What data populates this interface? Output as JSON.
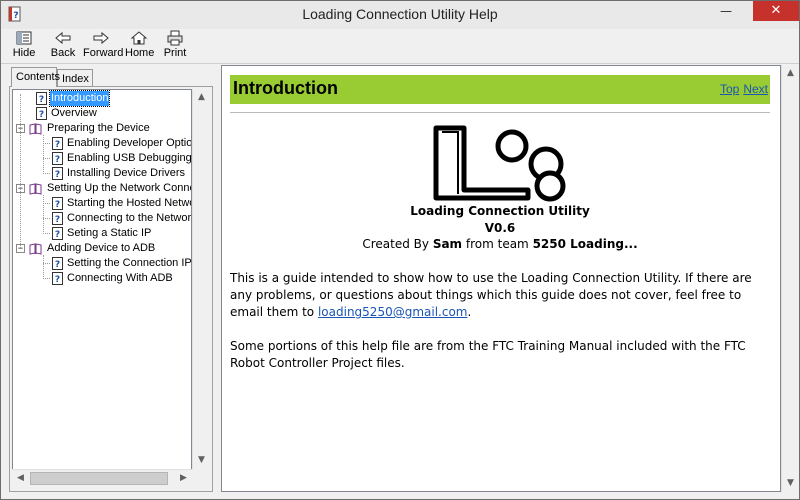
{
  "window": {
    "title": "Loading Connection Utility Help",
    "minimize_glyph": "—",
    "close_glyph": "✕"
  },
  "toolbar": {
    "hide": "Hide",
    "back": "Back",
    "forward": "Forward",
    "home": "Home",
    "print": "Print"
  },
  "tabs": {
    "contents": "Contents",
    "index": "Index"
  },
  "tree": {
    "items": [
      {
        "label": "Introduction",
        "type": "page",
        "level": 1,
        "selected": true
      },
      {
        "label": "Overview",
        "type": "page",
        "level": 1
      },
      {
        "label": "Preparing the Device",
        "type": "book",
        "level": 0
      },
      {
        "label": "Enabling Developer Options",
        "type": "page",
        "level": 2
      },
      {
        "label": "Enabling USB Debugging",
        "type": "page",
        "level": 2
      },
      {
        "label": "Installing Device Drivers",
        "type": "page",
        "level": 2
      },
      {
        "label": "Setting Up the Network Connectio",
        "type": "book",
        "level": 0
      },
      {
        "label": "Starting the Hosted Network",
        "type": "page",
        "level": 2
      },
      {
        "label": "Connecting to the Network",
        "type": "page",
        "level": 2
      },
      {
        "label": "Seting a Static IP",
        "type": "page",
        "level": 2
      },
      {
        "label": "Adding Device to ADB",
        "type": "book",
        "level": 0
      },
      {
        "label": "Setting the Connection IP",
        "type": "page",
        "level": 2
      },
      {
        "label": "Connecting With ADB",
        "type": "page",
        "level": 2
      }
    ]
  },
  "content": {
    "heading": "Introduction",
    "link_top": "Top",
    "link_next": "Next",
    "app_name": "Loading Connection Utility",
    "version": "V0.6",
    "credit_prefix": "Created By ",
    "credit_name": "Sam",
    "credit_mid": " from team ",
    "credit_team": "5250 Loading...",
    "para1": "This is a guide intended to show how to use the Loading Connection Utility. If there are any problems, or questions about things which this guide does not cover, feel free to email them to ",
    "email": "loading5250@gmail.com",
    "para1_end": ".",
    "para2": "Some portions of this help file are from the FTC Training Manual included with the FTC Robot Controller Project files."
  },
  "colors": {
    "header_green": "#99cc33",
    "link_blue": "#1a55b5",
    "selection_blue": "#3399ff",
    "close_red": "#c7312b"
  }
}
